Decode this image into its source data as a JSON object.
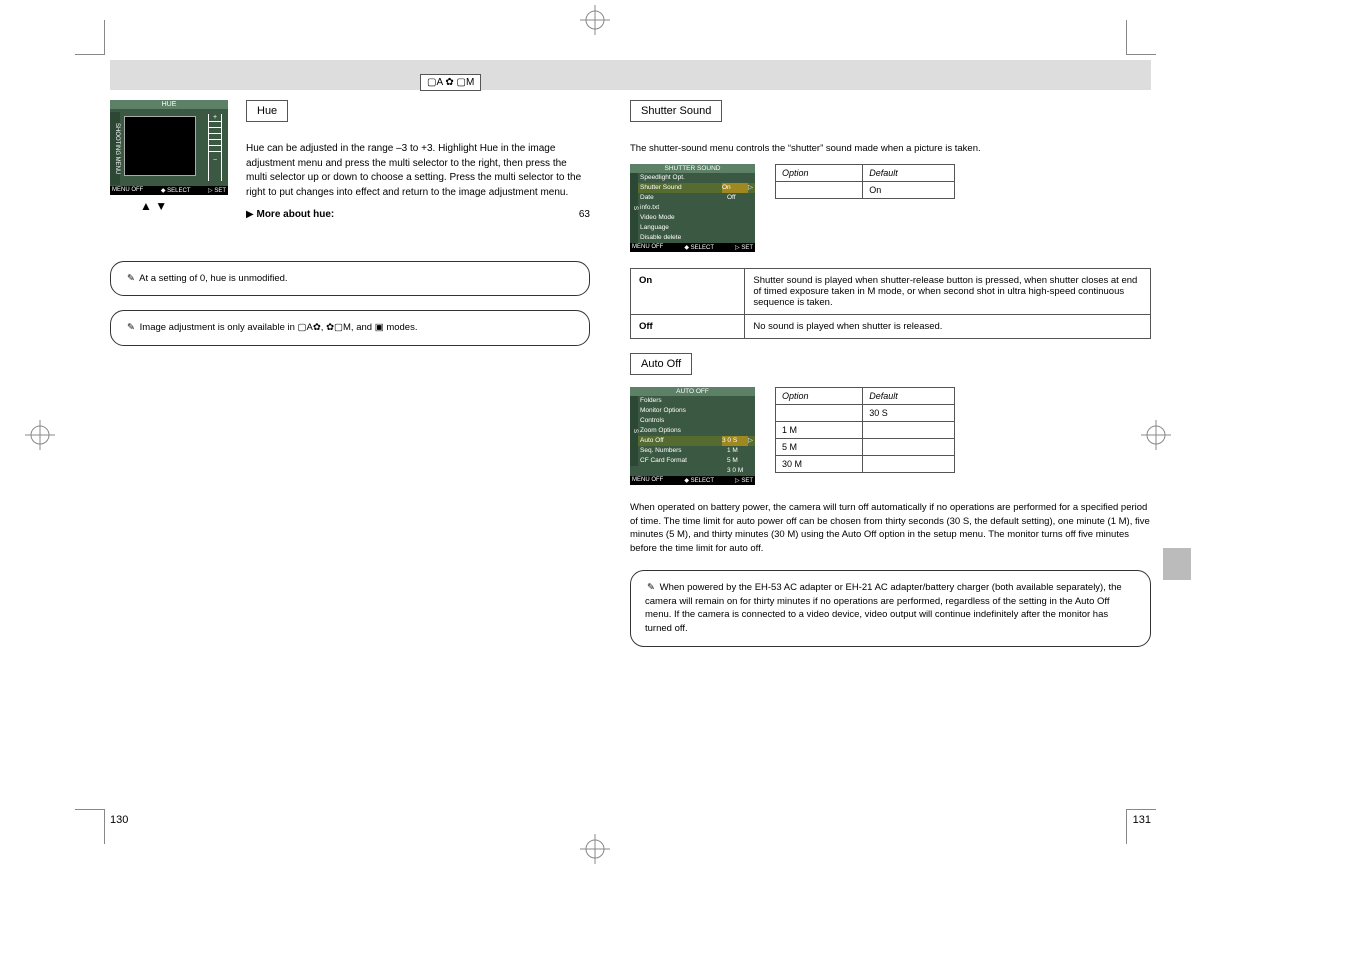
{
  "domain": "Document",
  "header": {
    "icons_label": "▢A ✿ ▢M"
  },
  "left": {
    "submenu_label": "Hue",
    "hue_screen": {
      "title": "HUE",
      "side": "SHOOTING MENU",
      "plus": "+",
      "minus": "−",
      "bottom_off": "MENU OFF",
      "bottom_select": "◆ SELECT",
      "bottom_set": "▷ SET"
    },
    "arrows": "▲     ▼",
    "para1": "Hue can be adjusted in the range –3 to +3. Highlight Hue in the image adjustment menu and press the multi selector to the right, then press the multi selector up or down to choose a setting. Press the multi selector to the right to put changes into effect and return to the image adjustment menu.",
    "more_link": "More about hue:",
    "more_icon": "▶",
    "more_page": "63",
    "callout1_line1": "At a setting of 0, hue is unmodified.",
    "callout2_text": "Image adjustment is only available in ▢A✿, ✿▢M, and ▣ modes."
  },
  "right": {
    "shutter": {
      "submenu_label": "Shutter Sound",
      "intro": "The shutter-sound menu controls the “shutter” sound made when a picture is taken.",
      "screen": {
        "title": "SHUTTER SOUND",
        "items": [
          {
            "lbl": "Speedlight Opt.",
            "val": ""
          },
          {
            "lbl": "Shutter Sound",
            "val": "On"
          },
          {
            "lbl": "Date",
            "val": "Off"
          },
          {
            "lbl": "info.txt",
            "val": ""
          },
          {
            "lbl": "Video Mode",
            "val": ""
          },
          {
            "lbl": "Language",
            "val": ""
          },
          {
            "lbl": "Disable delete",
            "val": ""
          }
        ],
        "side": "S",
        "bottom_off": "MENU OFF",
        "bottom_select": "◆ SELECT",
        "bottom_set": "▷ SET"
      },
      "mini_table": {
        "h1": "Option",
        "h2": "Default",
        "r1": "On"
      },
      "table": [
        {
          "opt": "On",
          "desc": "Shutter sound is played when shutter-release button is pressed, when shutter closes at end of timed exposure taken in M mode, or when second shot in ultra high-speed continuous sequence is taken."
        },
        {
          "opt": "Off",
          "desc": "No sound is played when shutter is released."
        }
      ]
    },
    "autooff": {
      "submenu_label": "Auto Off",
      "intro": "When operated on battery power, the camera will turn off automatically if no operations are performed for a specified period of time. The time limit for auto power off can be chosen from thirty seconds (30 S, the default setting), one minute (1 M), five minutes (5 M), and thirty minutes (30 M) using the Auto Off option in the setup menu. The monitor turns off five minutes before the time limit for auto off.",
      "screen": {
        "title": "AUTO OFF",
        "items": [
          {
            "lbl": "Folders",
            "val": ""
          },
          {
            "lbl": "Monitor Options",
            "val": ""
          },
          {
            "lbl": "Controls",
            "val": ""
          },
          {
            "lbl": "Zoom Options",
            "val": ""
          },
          {
            "lbl": "Auto Off",
            "val": "3 0 S"
          },
          {
            "lbl": "Seq. Numbers",
            "val": "1 M"
          },
          {
            "lbl": "CF Card Format",
            "val": "5 M"
          },
          {
            "lbl": "",
            "val": "3 0 M"
          }
        ],
        "side": "S",
        "bottom_off": "MENU OFF",
        "bottom_select": "◆ SELECT",
        "bottom_set": "▷ SET"
      },
      "mini_table": {
        "h1": "Option",
        "h2": "Default",
        "r1": "30 S",
        "r2": "1 M",
        "r3": "5 M",
        "r4": "30 M"
      },
      "callout": "When powered by the EH-53 AC adapter or EH-21 AC adapter/battery charger (both available separately), the camera will remain on for thirty minutes if no operations are performed, regardless of the setting in the Auto Off menu.  If the camera is connected to a video device, video output will continue indefinitely after the monitor has turned off."
    }
  },
  "page_left": "130",
  "page_right": "131"
}
